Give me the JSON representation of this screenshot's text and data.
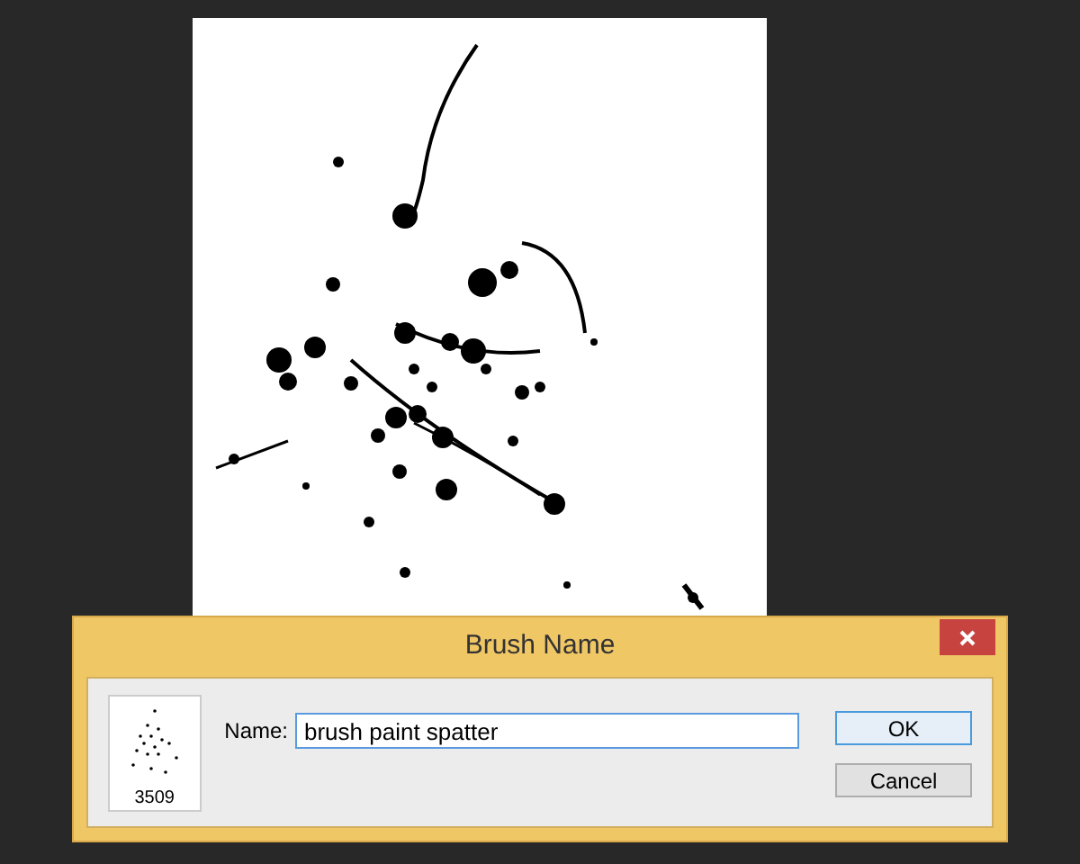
{
  "dialog": {
    "title": "Brush Name",
    "preview": {
      "caption": "3509"
    },
    "name_field": {
      "label": "Name:",
      "value": "brush paint spatter"
    },
    "buttons": [
      {
        "label": "OK",
        "kind": "default"
      },
      {
        "label": "Cancel",
        "kind": "normal"
      }
    ]
  }
}
